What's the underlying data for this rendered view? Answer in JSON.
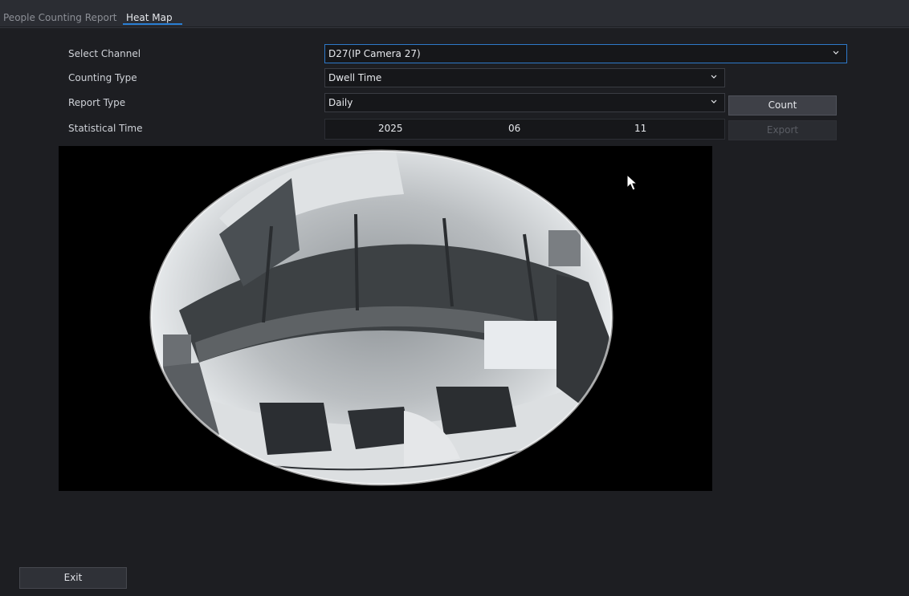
{
  "tabs": {
    "people_counting_report": "People Counting Report",
    "heat_map": "Heat Map"
  },
  "form": {
    "select_channel_label": "Select Channel",
    "select_channel_value": "D27(IP Camera 27)",
    "counting_type_label": "Counting Type",
    "counting_type_value": "Dwell Time",
    "report_type_label": "Report Type",
    "report_type_value": "Daily",
    "statistical_time_label": "Statistical Time",
    "year": "2025",
    "month": "06",
    "day": "11"
  },
  "buttons": {
    "count": "Count",
    "export": "Export",
    "exit": "Exit"
  },
  "colors": {
    "accent": "#2a7fd4",
    "background": "#1d1e22",
    "tab_bar": "#2b2d33"
  }
}
